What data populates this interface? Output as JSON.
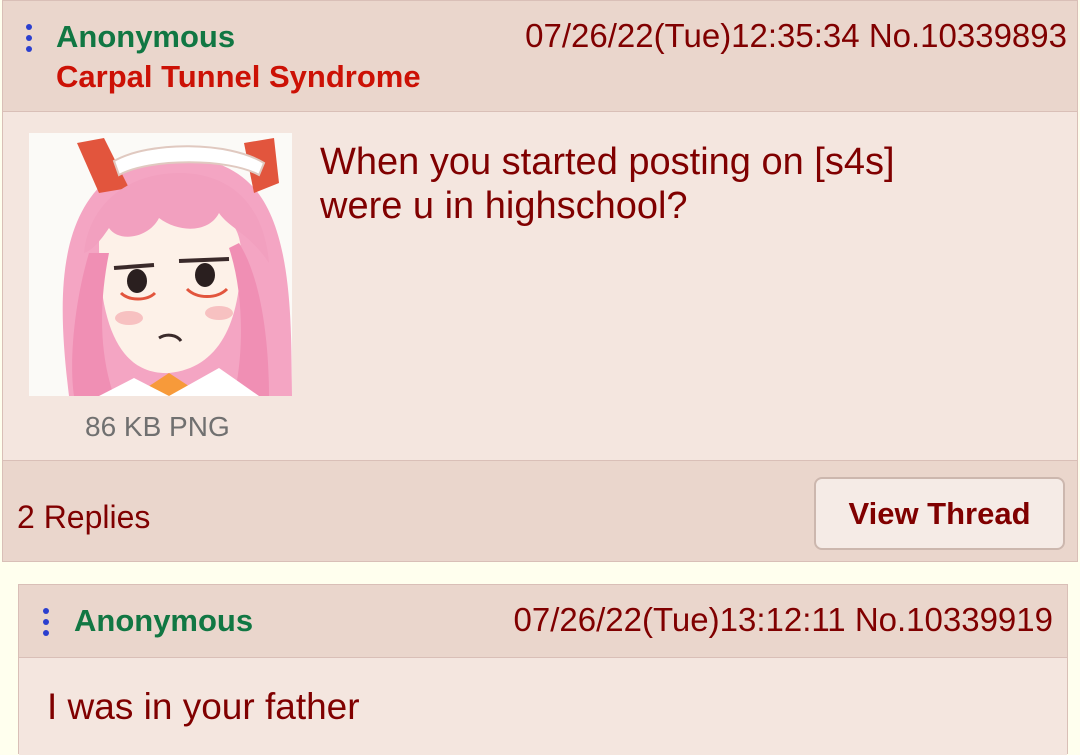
{
  "op": {
    "name": "Anonymous",
    "subject": "Carpal Tunnel Syndrome",
    "datetime": "07/26/22(Tue)12:35:34",
    "post_no": "No.10339893",
    "comment": "When you started posting on [s4s]\nwere u in highschool?",
    "file_info": "86 KB PNG",
    "thumbnail_icon": "anime-girl-thumbnail",
    "replies_text": "2 Replies",
    "view_thread_label": "View Thread"
  },
  "reply": {
    "name": "Anonymous",
    "datetime": "07/26/22(Tue)13:12:11",
    "post_no": "No.10339919",
    "comment": "I was in your father"
  },
  "colors": {
    "name": "#117743",
    "subject": "#cc1105",
    "text": "#800000",
    "kebab": "#2b3fcf",
    "post_bg": "#f0e0d6",
    "page_bg": "#ffffee"
  }
}
